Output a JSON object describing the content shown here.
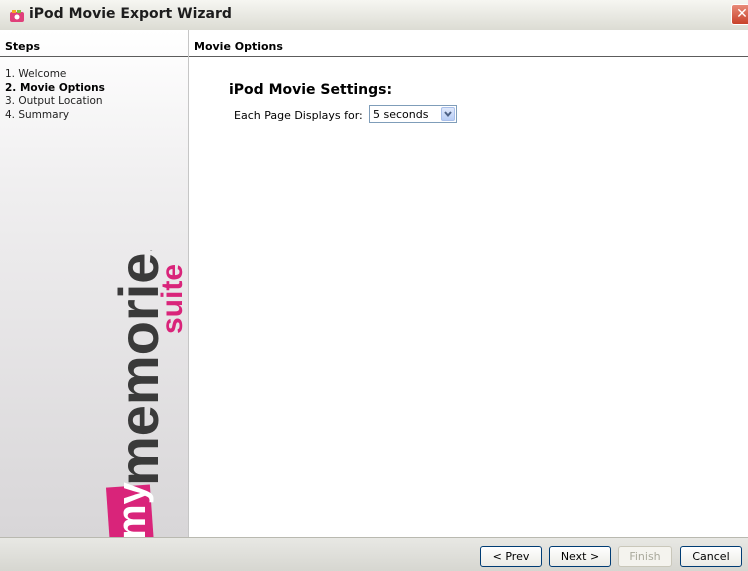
{
  "window": {
    "title": "iPod Movie Export Wizard",
    "close_glyph": "✕"
  },
  "sidebar": {
    "header": "Steps",
    "steps": [
      "1. Welcome",
      "2. Movie Options",
      "3. Output Location",
      "4. Summary"
    ],
    "active_step": 1,
    "logo": {
      "my": "my",
      "memories": "memories",
      "suite": "suite",
      "accent_color": "#d9247a",
      "text_color": "#3a3a3a"
    }
  },
  "main": {
    "header": "Movie Options",
    "settings_title": "iPod Movie Settings:",
    "page_display_label": "Each Page Displays for:",
    "page_display_value": "5 seconds"
  },
  "buttons": {
    "prev": "< Prev",
    "next": "Next >",
    "finish": "Finish",
    "cancel": "Cancel"
  }
}
